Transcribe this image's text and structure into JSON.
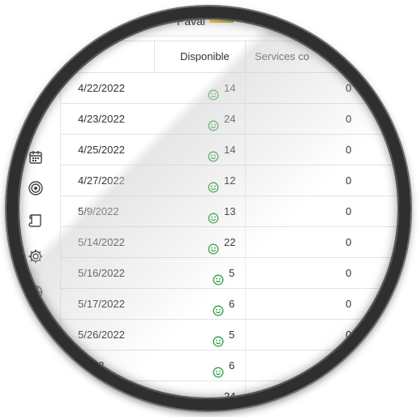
{
  "header": {
    "user_name": "Paval"
  },
  "table": {
    "columns": {
      "date": "",
      "available": "Disponible",
      "services": "Services co"
    },
    "rows": [
      {
        "date": "4/22/2022",
        "available": "14",
        "services": "0"
      },
      {
        "date": "4/23/2022",
        "available": "24",
        "services": "0"
      },
      {
        "date": "4/25/2022",
        "available": "14",
        "services": "0"
      },
      {
        "date": "4/27/2022",
        "available": "12",
        "services": "0"
      },
      {
        "date": "5/9/2022",
        "available": "13",
        "services": "0"
      },
      {
        "date": "5/14/2022",
        "available": "22",
        "services": "0"
      },
      {
        "date": "5/16/2022",
        "available": "5",
        "services": "0"
      },
      {
        "date": "5/17/2022",
        "available": "6",
        "services": "0"
      },
      {
        "date": "5/26/2022",
        "available": "5",
        "services": "0"
      },
      {
        "date": "/2022",
        "available": "6",
        "services": ""
      },
      {
        "date": "",
        "available": "24",
        "services": ""
      }
    ]
  },
  "sidebar": {
    "icons": [
      "calendar-icon",
      "target-icon",
      "scroll-icon",
      "gear-icon",
      "globe-icon"
    ]
  },
  "colors": {
    "smile": "#2e9e3e",
    "border": "#e2e2e2",
    "text": "#333333"
  }
}
